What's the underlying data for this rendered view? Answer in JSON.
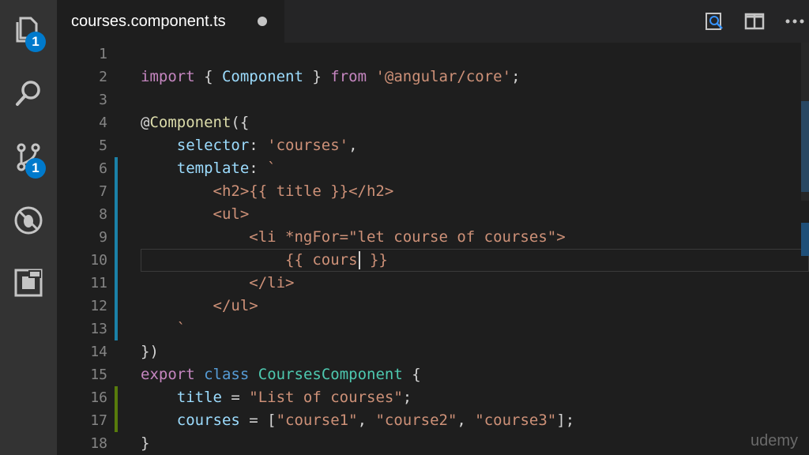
{
  "activity_bar": {
    "explorer_badge": "1",
    "scm_badge": "1",
    "items": [
      "files-icon",
      "search-icon",
      "source-control-icon",
      "debug-icon",
      "extensions-icon"
    ]
  },
  "tab": {
    "title": "courses.component.ts",
    "dirty": true
  },
  "tab_actions": [
    "open-preview-icon",
    "split-editor-icon",
    "more-actions-icon"
  ],
  "editor": {
    "line_numbers": [
      "1",
      "2",
      "3",
      "4",
      "5",
      "6",
      "7",
      "8",
      "9",
      "10",
      "11",
      "12",
      "13",
      "14",
      "15",
      "16",
      "17",
      "18"
    ],
    "lines": [
      {
        "segments": []
      },
      {
        "segments": [
          {
            "c": "k",
            "t": "import"
          },
          {
            "c": "d",
            "t": " { "
          },
          {
            "c": "v",
            "t": "Component"
          },
          {
            "c": "d",
            "t": " } "
          },
          {
            "c": "k",
            "t": "from"
          },
          {
            "c": "d",
            "t": " "
          },
          {
            "c": "s",
            "t": "'@angular/core'"
          },
          {
            "c": "d",
            "t": ";"
          }
        ]
      },
      {
        "segments": []
      },
      {
        "segments": [
          {
            "c": "d",
            "t": "@"
          },
          {
            "c": "y",
            "t": "Component"
          },
          {
            "c": "d",
            "t": "({"
          }
        ]
      },
      {
        "segments": [
          {
            "c": "d",
            "t": "    "
          },
          {
            "c": "v",
            "t": "selector"
          },
          {
            "c": "d",
            "t": ": "
          },
          {
            "c": "s",
            "t": "'courses'"
          },
          {
            "c": "d",
            "t": ","
          }
        ]
      },
      {
        "segments": [
          {
            "c": "d",
            "t": "    "
          },
          {
            "c": "v",
            "t": "template"
          },
          {
            "c": "d",
            "t": ": "
          },
          {
            "c": "s",
            "t": "`"
          }
        ]
      },
      {
        "segments": [
          {
            "c": "s",
            "t": "        <h2>{{ title }}</h2>"
          }
        ]
      },
      {
        "segments": [
          {
            "c": "s",
            "t": "        <ul>"
          }
        ]
      },
      {
        "segments": [
          {
            "c": "s",
            "t": "            <li *ngFor=\"let course of courses\">"
          }
        ]
      },
      {
        "segments": [
          {
            "c": "s",
            "t": "                {{ cours"
          },
          {
            "c": "cursor",
            "t": ""
          },
          {
            "c": "s",
            "t": " }}"
          }
        ]
      },
      {
        "segments": [
          {
            "c": "s",
            "t": "            </li>"
          }
        ]
      },
      {
        "segments": [
          {
            "c": "s",
            "t": "        </ul>"
          }
        ]
      },
      {
        "segments": [
          {
            "c": "s",
            "t": "    `"
          }
        ]
      },
      {
        "segments": [
          {
            "c": "d",
            "t": "})"
          }
        ]
      },
      {
        "segments": [
          {
            "c": "k",
            "t": "export"
          },
          {
            "c": "d",
            "t": " "
          },
          {
            "c": "b",
            "t": "class"
          },
          {
            "c": "d",
            "t": " "
          },
          {
            "c": "t",
            "t": "CoursesComponent"
          },
          {
            "c": "d",
            "t": " {"
          }
        ]
      },
      {
        "segments": [
          {
            "c": "d",
            "t": "    "
          },
          {
            "c": "v",
            "t": "title"
          },
          {
            "c": "d",
            "t": " = "
          },
          {
            "c": "s",
            "t": "\"List of courses\""
          },
          {
            "c": "d",
            "t": ";"
          }
        ]
      },
      {
        "segments": [
          {
            "c": "d",
            "t": "    "
          },
          {
            "c": "v",
            "t": "courses"
          },
          {
            "c": "d",
            "t": " = ["
          },
          {
            "c": "s",
            "t": "\"course1\""
          },
          {
            "c": "d",
            "t": ", "
          },
          {
            "c": "s",
            "t": "\"course2\""
          },
          {
            "c": "d",
            "t": ", "
          },
          {
            "c": "s",
            "t": "\"course3\""
          },
          {
            "c": "d",
            "t": "];"
          }
        ]
      },
      {
        "segments": [
          {
            "c": "d",
            "t": "}"
          }
        ]
      }
    ],
    "git_modified_color": "#1b81a8",
    "git_added_color": "#587c0c"
  },
  "watermark": "udemy",
  "colors": {
    "activity_bar_bg": "#333333",
    "editor_bg": "#1e1e1e",
    "accent": "#007acc"
  }
}
